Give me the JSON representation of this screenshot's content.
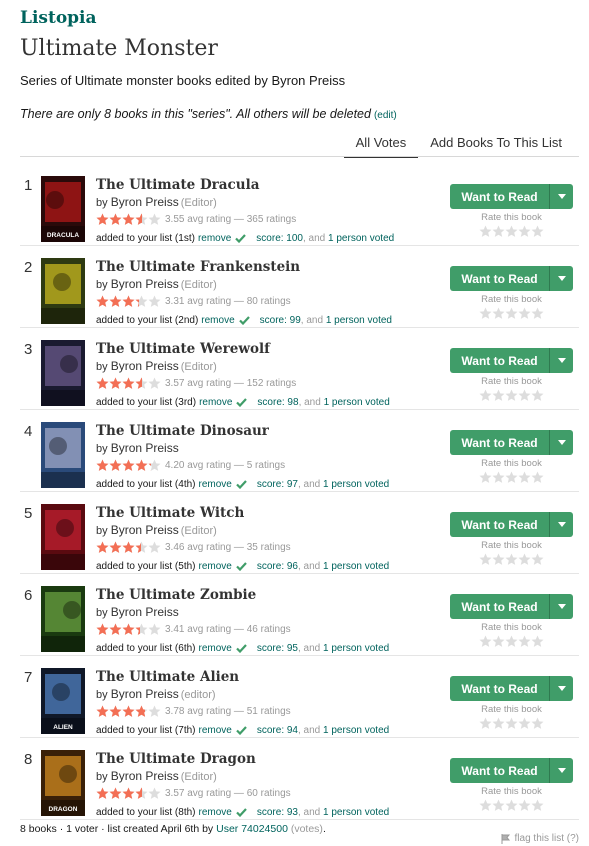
{
  "breadcrumb": "Listopia",
  "list_title": "Ultimate Monster",
  "description": "Series of Ultimate monster books edited by Byron Preiss",
  "note": "There are only 8 books in this \"series\". All others will be deleted",
  "note_edit": "(edit)",
  "tabs": [
    {
      "label": "All Votes",
      "active": true
    },
    {
      "label": "Add Books To This List",
      "active": false
    }
  ],
  "buttons": {
    "want_to_read": "Want to Read",
    "rate_this_book": "Rate this book",
    "remove": "remove"
  },
  "colors": {
    "brand": "#00635d",
    "button_green": "#409d69",
    "star_filled": "#f36f55",
    "star_empty": "#dddddd"
  },
  "books": [
    {
      "rank": "1",
      "title": "The Ultimate Dracula",
      "by": "by",
      "author": "Byron Preiss",
      "role": "(Editor)",
      "avg_rating": 3.55,
      "rating_text": "3.55 avg rating — 365 ratings",
      "added_text": "added to your list (1st)",
      "score_text": "score: 100",
      "votes_sep": ", and",
      "votes_text": "1 person voted",
      "cover": {
        "bg": "#2a0a0a",
        "accent": "#b01818",
        "text": "DRACULA"
      }
    },
    {
      "rank": "2",
      "title": "The Ultimate Frankenstein",
      "by": "by",
      "author": "Byron Preiss",
      "role": "(Editor)",
      "avg_rating": 3.31,
      "rating_text": "3.31 avg rating — 80 ratings",
      "added_text": "added to your list (2nd)",
      "score_text": "score: 99",
      "votes_sep": ", and",
      "votes_text": "1 person voted",
      "cover": {
        "bg": "#2e3a12",
        "accent": "#c8b820",
        "text": ""
      }
    },
    {
      "rank": "3",
      "title": "The Ultimate Werewolf",
      "by": "by",
      "author": "Byron Preiss",
      "role": "(Editor)",
      "avg_rating": 3.57,
      "rating_text": "3.57 avg rating — 152 ratings",
      "added_text": "added to your list (3rd)",
      "score_text": "score: 98",
      "votes_sep": ", and",
      "votes_text": "1 person voted",
      "cover": {
        "bg": "#1a1a30",
        "accent": "#6a5a8a",
        "text": ""
      }
    },
    {
      "rank": "4",
      "title": "The Ultimate Dinosaur",
      "by": "by",
      "author": "Byron Preiss",
      "role": "",
      "avg_rating": 4.2,
      "rating_text": "4.20 avg rating — 5 ratings",
      "added_text": "added to your list (4th)",
      "score_text": "score: 97",
      "votes_sep": ", and",
      "votes_text": "1 person voted",
      "cover": {
        "bg": "#2a4a7a",
        "accent": "#a0a8c8",
        "text": ""
      }
    },
    {
      "rank": "5",
      "title": "The Ultimate Witch",
      "by": "by",
      "author": "Byron Preiss",
      "role": "(Editor)",
      "avg_rating": 3.46,
      "rating_text": "3.46 avg rating — 35 ratings",
      "added_text": "added to your list (5th)",
      "score_text": "score: 96",
      "votes_sep": ", and",
      "votes_text": "1 person voted",
      "cover": {
        "bg": "#5a0a10",
        "accent": "#c02030",
        "text": ""
      }
    },
    {
      "rank": "6",
      "title": "The Ultimate Zombie",
      "by": "by",
      "author": "Byron Preiss",
      "role": "",
      "avg_rating": 3.41,
      "rating_text": "3.41 avg rating — 46 ratings",
      "added_text": "added to your list (6th)",
      "score_text": "score: 95",
      "votes_sep": ", and",
      "votes_text": "1 person voted",
      "cover": {
        "bg": "#1a3a10",
        "accent": "#6aa040",
        "text": ""
      }
    },
    {
      "rank": "7",
      "title": "The Ultimate Alien",
      "by": "by",
      "author": "Byron Preiss",
      "role": "(editor)",
      "avg_rating": 3.78,
      "rating_text": "3.78 avg rating — 51 ratings",
      "added_text": "added to your list (7th)",
      "score_text": "score: 94",
      "votes_sep": ", and",
      "votes_text": "1 person voted",
      "cover": {
        "bg": "#101828",
        "accent": "#5080c0",
        "text": "ALIEN"
      }
    },
    {
      "rank": "8",
      "title": "The Ultimate Dragon",
      "by": "by",
      "author": "Byron Preiss",
      "role": "(Editor)",
      "avg_rating": 3.57,
      "rating_text": "3.57 avg rating — 60 ratings",
      "added_text": "added to your list (8th)",
      "score_text": "score: 93",
      "votes_sep": ", and",
      "votes_text": "1 person voted",
      "cover": {
        "bg": "#3a2008",
        "accent": "#d08a20",
        "text": "DRAGON"
      }
    }
  ],
  "footer": {
    "summary": "8 books · 1 voter · list created April 6th by",
    "user": "User 74024500",
    "votes_link": "(votes)",
    "end": ".",
    "flag": "flag this list (?)"
  }
}
